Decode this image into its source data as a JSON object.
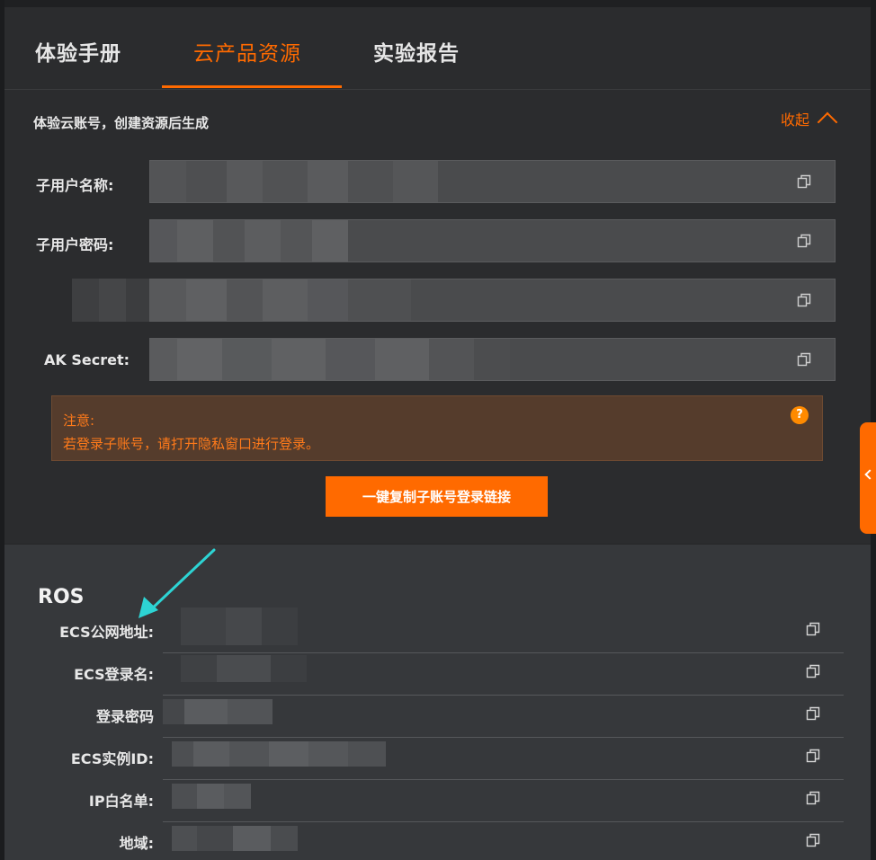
{
  "tabs": [
    {
      "label": "体验手册",
      "active": false
    },
    {
      "label": "云产品资源",
      "active": true
    },
    {
      "label": "实验报告",
      "active": false
    }
  ],
  "account": {
    "header": "体验云账号，创建资源后生成",
    "collapse_label": "收起",
    "fields": [
      {
        "label": "子用户名称:"
      },
      {
        "label": "子用户密码:"
      },
      {
        "label": ""
      },
      {
        "label": "AK Secret:"
      }
    ],
    "notice": {
      "title": "注意:",
      "text": "若登录子账号，请打开隐私窗口进行登录。",
      "help_icon": "?"
    },
    "copy_button": "一键复制子账号登录链接"
  },
  "ros": {
    "title": "ROS",
    "rows": [
      {
        "label": "ECS公网地址:"
      },
      {
        "label": "ECS登录名:"
      },
      {
        "label": "登录密码"
      },
      {
        "label": "ECS实例ID:"
      },
      {
        "label": "IP白名单:"
      },
      {
        "label": "地域:"
      }
    ]
  },
  "colors": {
    "accent": "#ff6a00",
    "annotation_arrow": "#2dd4d4",
    "panel_bg": "#2b2c2e",
    "ros_bg": "#36383b"
  },
  "icons": [
    "copy-icon",
    "chevron-up-icon",
    "help-icon",
    "chevron-left-icon",
    "annotation-arrow-icon"
  ]
}
